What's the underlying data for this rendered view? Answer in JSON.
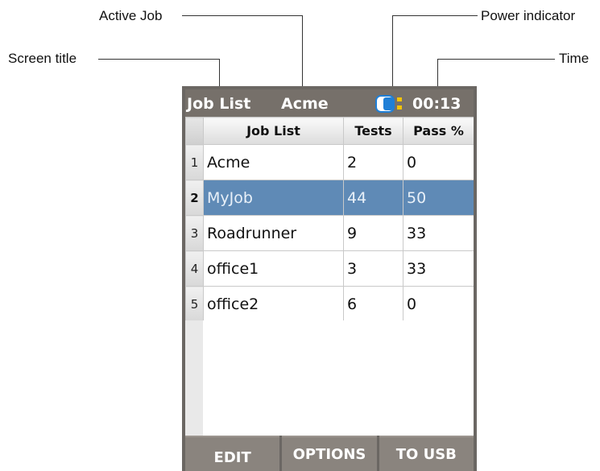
{
  "annotations": {
    "active_job": "Active Job",
    "power_indicator": "Power indicator",
    "screen_title": "Screen title",
    "time": "Time"
  },
  "status_bar": {
    "title": "Job List",
    "active_job": "Acme",
    "time": "00:13",
    "power_icon": "battery-icon",
    "colors": {
      "bar": "#76706a",
      "battery": "#1f7fd6",
      "battery_dots": "#f5c400"
    }
  },
  "table": {
    "columns": [
      "Job List",
      "Tests",
      "Pass %"
    ],
    "rows": [
      {
        "num": "1",
        "job": "Acme",
        "tests": "2",
        "pass": "0"
      },
      {
        "num": "2",
        "job": "MyJob",
        "tests": "44",
        "pass": "50"
      },
      {
        "num": "3",
        "job": "Roadrunner",
        "tests": "9",
        "pass": "33"
      },
      {
        "num": "4",
        "job": "office1",
        "tests": "3",
        "pass": "33"
      },
      {
        "num": "5",
        "job": "office2",
        "tests": "6",
        "pass": "0"
      }
    ],
    "selected_row": "2",
    "colors": {
      "selection": "#5f8ab6"
    }
  },
  "softkeys": [
    "EDIT",
    "OPTIONS",
    "TO USB"
  ]
}
